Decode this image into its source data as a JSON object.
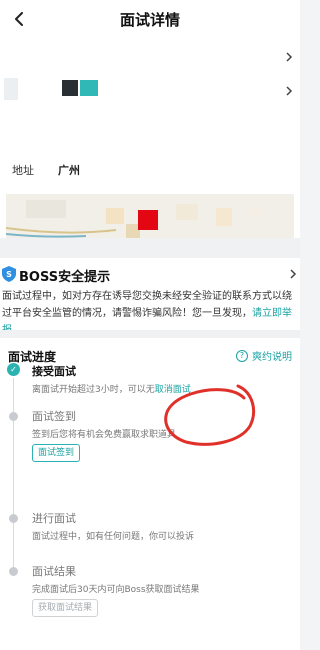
{
  "header": {
    "title": "面试详情"
  },
  "info": {
    "address_label": "地址",
    "address_value": "广州"
  },
  "safety": {
    "title": "BOSS安全提示",
    "body": "面试过程中，如对方存在诱导您交换未经安全验证的联系方式以绕过平台安全监管的情况，请警惕诈骗风险！您一旦发现，",
    "report_link": "请立即举报"
  },
  "progress": {
    "title": "面试进度",
    "help_label": "爽约说明",
    "steps": [
      {
        "title": "接受面试",
        "desc": "离面试开始超过3小时，可以无",
        "desc_link": "取消面试"
      },
      {
        "title": "面试签到",
        "desc": "签到后您将有机会免费赢取求职道具",
        "button": "面试签到"
      },
      {
        "title": "进行面试",
        "desc": "面试过程中，如有任何问题，你可以投诉"
      },
      {
        "title": "面试结果",
        "desc": "完成面试后30天内可向Boss获取面试结果",
        "button": "获取面试结果"
      }
    ]
  },
  "colors": {
    "accent": "#2bb3b1",
    "annotation": "#e0302a"
  }
}
